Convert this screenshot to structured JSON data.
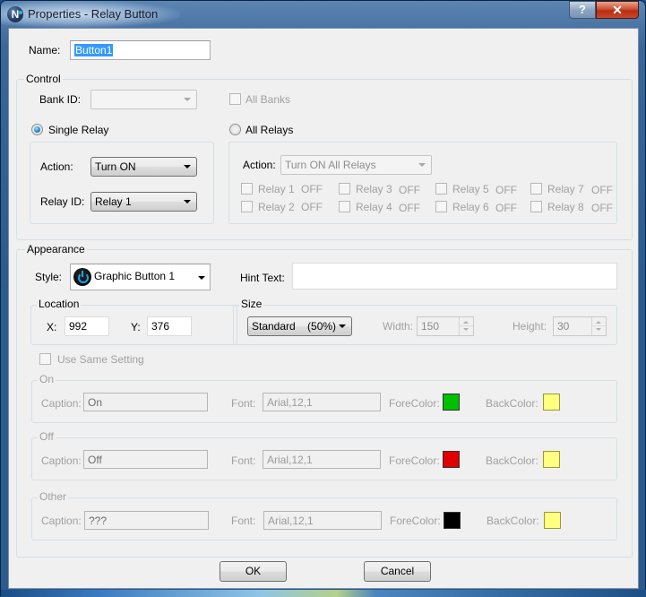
{
  "window": {
    "title": "Properties - Relay Button",
    "app_icon_letter": "N",
    "help_glyph": "?",
    "close_glyph": "✕"
  },
  "name": {
    "label": "Name:",
    "value": "Button1"
  },
  "control": {
    "title": "Control",
    "bank_id": {
      "label": "Bank ID:",
      "value": ""
    },
    "all_banks": {
      "label": "All Banks",
      "checked": false
    },
    "single_relay": {
      "label": "Single Relay",
      "selected": true,
      "action": {
        "label": "Action:",
        "value": "Turn ON"
      },
      "relay_id": {
        "label": "Relay ID:",
        "value": "Relay 1"
      }
    },
    "all_relays": {
      "label": "All Relays",
      "selected": false,
      "action": {
        "label": "Action:",
        "value": "Turn ON All Relays"
      },
      "relays": [
        {
          "label": "Relay 1",
          "state": "OFF"
        },
        {
          "label": "Relay 2",
          "state": "OFF"
        },
        {
          "label": "Relay 3",
          "state": "OFF"
        },
        {
          "label": "Relay 4",
          "state": "OFF"
        },
        {
          "label": "Relay 5",
          "state": "OFF"
        },
        {
          "label": "Relay 6",
          "state": "OFF"
        },
        {
          "label": "Relay 7",
          "state": "OFF"
        },
        {
          "label": "Relay 8",
          "state": "OFF"
        }
      ]
    }
  },
  "appearance": {
    "title": "Appearance",
    "style": {
      "label": "Style:",
      "value": "Graphic Button 1",
      "icon": "power-button-icon"
    },
    "hint_text": {
      "label": "Hint Text:",
      "value": ""
    },
    "location": {
      "title": "Location",
      "x": {
        "label": "X:",
        "value": "992"
      },
      "y": {
        "label": "Y:",
        "value": "376"
      }
    },
    "size": {
      "title": "Size",
      "preset": "Standard    (50%)",
      "width": {
        "label": "Width:",
        "value": "150"
      },
      "height": {
        "label": "Height:",
        "value": "30"
      }
    },
    "use_same_setting": {
      "label": "Use Same Setting",
      "checked": false
    },
    "states": [
      {
        "title": "On",
        "caption_label": "Caption:",
        "caption": "On",
        "font_label": "Font:",
        "font": "Arial,12,1",
        "fore_label": "ForeColor:",
        "fore_color": "#00c000",
        "back_label": "BackColor:",
        "back_color": "#ffff80"
      },
      {
        "title": "Off",
        "caption_label": "Caption:",
        "caption": "Off",
        "font_label": "Font:",
        "font": "Arial,12,1",
        "fore_label": "ForeColor:",
        "fore_color": "#e00000",
        "back_label": "BackColor:",
        "back_color": "#ffff80"
      },
      {
        "title": "Other",
        "caption_label": "Caption:",
        "caption": "???",
        "font_label": "Font:",
        "font": "Arial,12,1",
        "fore_label": "ForeColor:",
        "fore_color": "#000000",
        "back_label": "BackColor:",
        "back_color": "#ffff80"
      }
    ]
  },
  "buttons": {
    "ok": "OK",
    "cancel": "Cancel"
  }
}
